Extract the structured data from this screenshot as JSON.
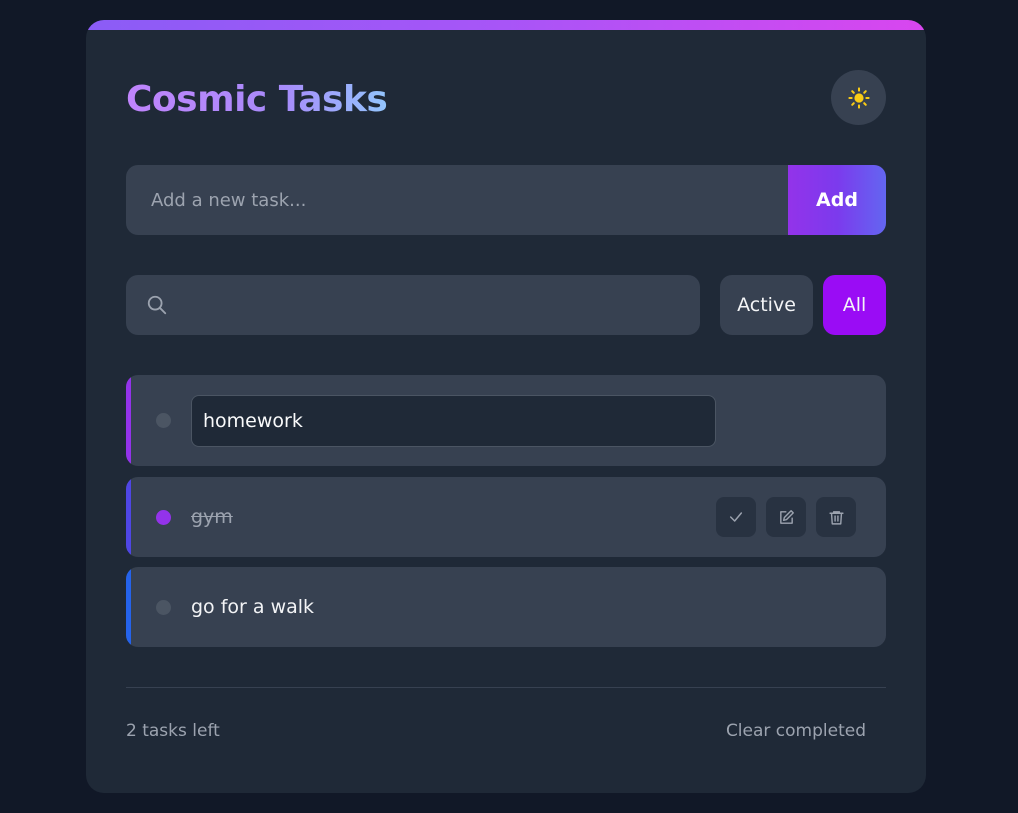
{
  "app": {
    "title": "Cosmic Tasks",
    "theme_toggle_icon": "sun-icon"
  },
  "add_task": {
    "placeholder": "Add a new task...",
    "button_label": "Add"
  },
  "search": {
    "icon": "search-icon",
    "value": ""
  },
  "filters": {
    "active_label": "Active",
    "all_label": "All",
    "selected": "All"
  },
  "tasks": [
    {
      "text": "homework",
      "completed": false,
      "editing": true,
      "accent_color": "#9333ea",
      "dot_color": "#4b5563"
    },
    {
      "text": "gym",
      "completed": true,
      "editing": false,
      "accent_color": "#4f46e5",
      "dot_color": "#9333ea",
      "actions": [
        "check-icon",
        "edit-icon",
        "trash-icon"
      ]
    },
    {
      "text": "go for a walk",
      "completed": false,
      "editing": false,
      "accent_color": "#2563eb",
      "dot_color": "#4b5563"
    }
  ],
  "footer": {
    "tasks_left": "2 tasks left",
    "clear_label": "Clear completed"
  },
  "colors": {
    "background": "#111827",
    "card": "#1f2937",
    "surface": "#374151",
    "accent_purple": "#9a0cf5",
    "sun": "#facc15"
  }
}
